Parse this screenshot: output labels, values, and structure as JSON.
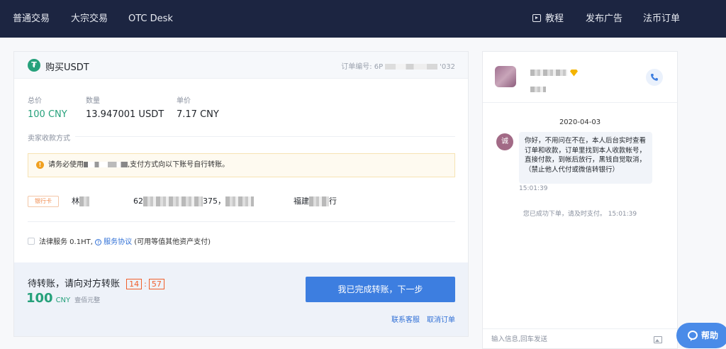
{
  "nav": {
    "left_items": [
      "普通交易",
      "大宗交易",
      "OTC Desk"
    ],
    "tutorial": "教程",
    "post_ad": "发布广告",
    "fiat_orders": "法币订单"
  },
  "order": {
    "logo_letter": "₮",
    "title": "购买USDT",
    "order_no_label": "订单编号: 6P",
    "order_no_tail": "'032",
    "total_label": "总价",
    "total_value": "100 CNY",
    "qty_label": "数量",
    "qty_value": "13.947001 USDT",
    "price_label": "单价",
    "price_value": "7.17 CNY",
    "payment_section_label": "卖家收款方式",
    "notice_prefix": "请务必使用",
    "notice_suffix": ",支付方式向以下账号自行转账。",
    "bank_tag": "银行卡",
    "acct_name_initial": "林",
    "acct_no_start": "62",
    "acct_no_end": "375",
    "acct_sep": "，",
    "bank_name_start": "福建",
    "bank_name_end": "行",
    "legal_label": "法律服务 0.1HT,",
    "service_agreement": "服务协议",
    "legal_note": "(可用等值其他资产支付)",
    "waiting_text": "待转账，请向对方转账",
    "timer_minutes": "14",
    "timer_seconds": "57",
    "amount_number": "100",
    "amount_currency": "CNY",
    "amount_chinese": "壹佰元整",
    "complete_button": "我已完成转账，下一步",
    "contact_support": "联系客服",
    "cancel_order": "取消订单"
  },
  "chat": {
    "avatar_letter": "诚",
    "date": "2020-04-03",
    "message": "你好，不用问在不在，本人后台实时查看订单和收款，订单里找到本人收款帐号，直接付款，到帐后放行，黑钱自觉取消，（禁止他人代付或微信转银行）",
    "message_time": "15:01:39",
    "system_message": "您已成功下单，请及时支付。 15:01:39",
    "input_placeholder": "输入信息,回车发送"
  },
  "help_button": "帮助",
  "colors": {
    "nav_bg": "#1c2541",
    "usdt_green": "#26a17b",
    "primary_blue": "#3d7ee0",
    "timer_orange": "#f0602c",
    "notice_bg": "#fefaf0"
  }
}
